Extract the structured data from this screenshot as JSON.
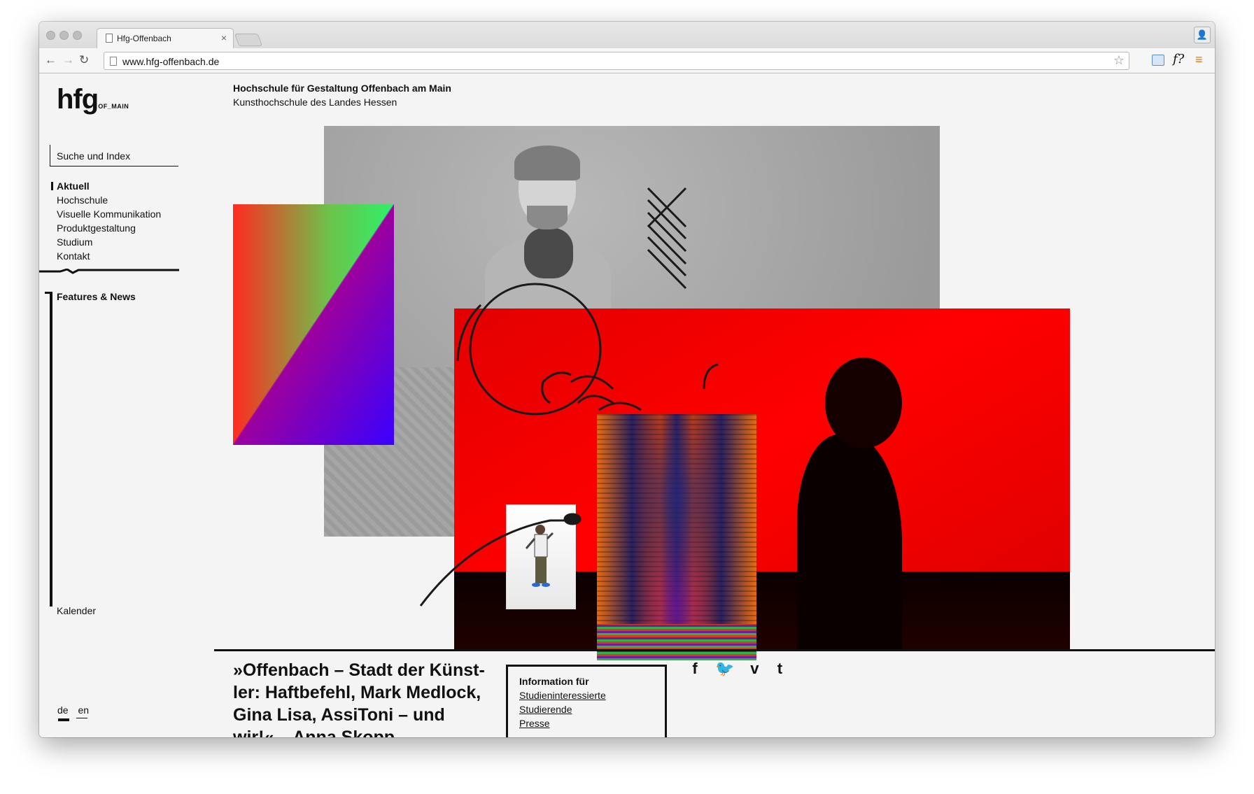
{
  "browser": {
    "tab_title": "Hfg-Offenbach",
    "tab_close": "×",
    "url": "www.hfg-offenbach.de",
    "back": "←",
    "forward": "→",
    "reload": "↻",
    "star": "☆",
    "ext_f": "f?",
    "menu": "≡",
    "profile": "👤"
  },
  "site": {
    "logo_main": "hfg",
    "logo_sub": "OF_MAIN",
    "header_title": "Hochschule für Gestaltung Offenbach am Main",
    "header_sub": "Kunsthochschule des Landes Hessen",
    "search_label": "Suche und Index",
    "nav": [
      {
        "label": "Aktuell",
        "active": true
      },
      {
        "label": "Hochschule"
      },
      {
        "label": "Visuelle Kommunikation"
      },
      {
        "label": "Produktgestaltung"
      },
      {
        "label": "Studium"
      },
      {
        "label": "Kontakt"
      }
    ],
    "features_title": "Features & News",
    "kalender": "Kalender",
    "lang": {
      "de": "de",
      "en": "en"
    }
  },
  "article": {
    "title": "»Offenbach – Stadt der Künst-ler: Haftbefehl, Mark Medlock, Gina Lisa, AssiToni – und wir!« – Anna Skopp"
  },
  "info_box": {
    "title": "Information für",
    "links": [
      "Studieninteressierte",
      "Studierende",
      "Presse"
    ]
  },
  "social": {
    "facebook": "f",
    "twitter": "🐦",
    "vimeo": "v",
    "tumblr": "t"
  },
  "colors": {
    "accent_red": "#ff0000",
    "ink": "#111111",
    "page_bg": "#f4f4f4",
    "menu_orange": "#e07a10"
  }
}
